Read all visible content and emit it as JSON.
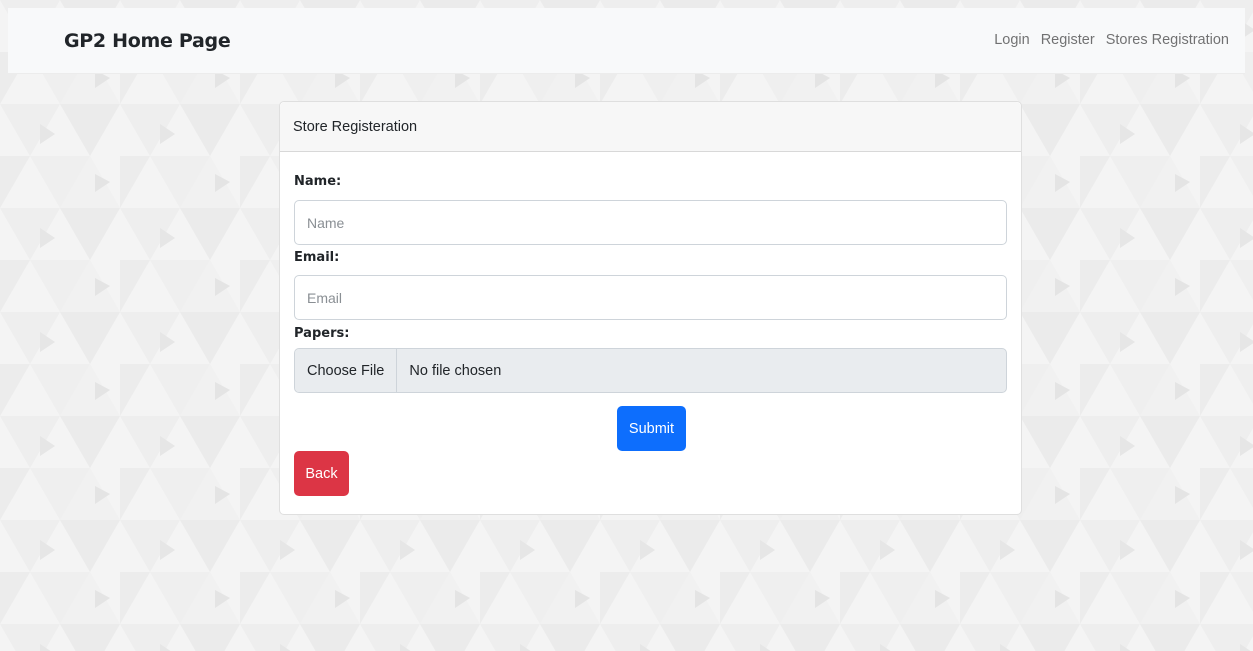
{
  "navbar": {
    "brand": "GP2 Home Page",
    "links": [
      "Login",
      "Register",
      "Stores Registration"
    ]
  },
  "card": {
    "header": "Store Registeration",
    "fields": {
      "name_label": "Name:",
      "name_placeholder": "Name",
      "email_label": "Email:",
      "email_placeholder": "Email",
      "papers_label": "Papers:",
      "file_button": "Choose File",
      "file_status": "No file chosen"
    },
    "submit_label": "Submit",
    "back_label": "Back"
  },
  "colors": {
    "primary": "#0d6efd",
    "danger": "#dc3545",
    "navbar_bg": "#f8f9fa",
    "page_bg": "#f4f4f4"
  }
}
